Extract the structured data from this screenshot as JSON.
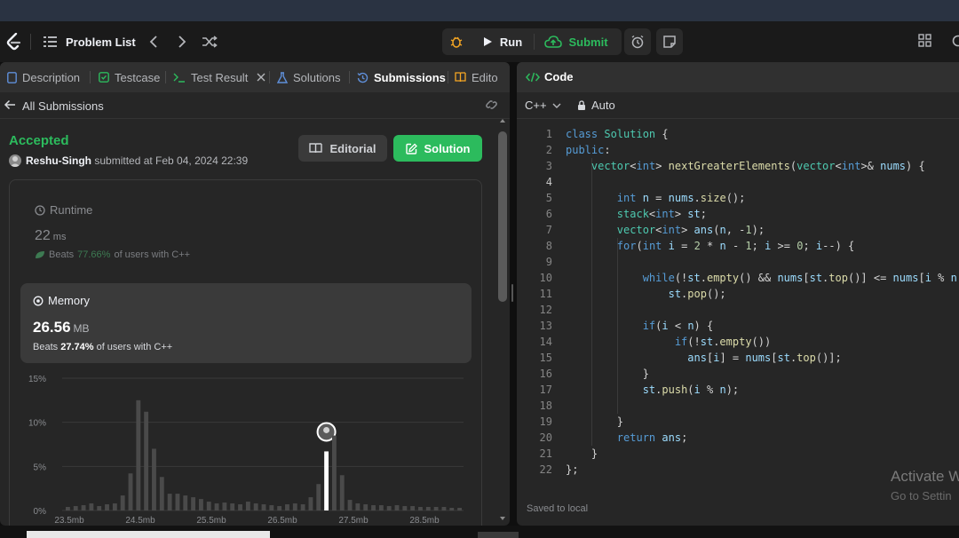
{
  "navbar": {
    "problem_list": "Problem List",
    "run": "Run",
    "submit": "Submit"
  },
  "left_tabs": [
    {
      "label": "Description"
    },
    {
      "label": "Testcase"
    },
    {
      "label": "Test Result"
    },
    {
      "label": "Solutions"
    },
    {
      "label": "Submissions"
    },
    {
      "label": "Edito"
    }
  ],
  "submission": {
    "back_label": "All Submissions",
    "status": "Accepted",
    "user": "Reshu-Singh",
    "submitted_text": "submitted at Feb 04, 2024 22:39",
    "editorial_btn": "Editorial",
    "solution_btn": "Solution",
    "runtime": {
      "title": "Runtime",
      "value": "22",
      "unit": "ms",
      "beats_label": "Beats",
      "beats_pct": "77.66%",
      "beats_suffix": "of users with C++"
    },
    "memory": {
      "title": "Memory",
      "value": "26.56",
      "unit": "MB",
      "beats_label": "Beats",
      "beats_pct": "27.74%",
      "beats_suffix": "of users with C++"
    }
  },
  "chart_data": {
    "type": "bar",
    "y_ticks": [
      "15%",
      "10%",
      "5%",
      "0%"
    ],
    "x_ticks": [
      "23.5mb",
      "24.5mb",
      "25.5mb",
      "26.5mb",
      "27.5mb",
      "28.5mb"
    ],
    "ylim": [
      0,
      15
    ],
    "values": [
      0.4,
      0.5,
      0.6,
      0.8,
      0.5,
      0.7,
      0.8,
      1.7,
      4.2,
      12.5,
      11.2,
      7.0,
      3.8,
      1.9,
      1.9,
      1.7,
      1.5,
      1.3,
      1.0,
      0.8,
      0.9,
      0.8,
      0.7,
      1.0,
      0.8,
      0.7,
      0.6,
      0.5,
      0.7,
      0.8,
      0.7,
      1.5,
      3.0,
      6.7,
      8.5,
      4.0,
      1.2,
      0.8,
      0.7,
      0.6,
      0.6,
      0.5,
      0.6,
      0.5,
      0.5,
      0.4,
      0.4,
      0.4,
      0.4,
      0.3,
      0.3
    ],
    "highlight_index": 33,
    "colors": {
      "bar": "#4a4a4a",
      "highlight": "#ffffff"
    }
  },
  "code_panel": {
    "tab_label": "Code",
    "language": "C++",
    "mode": "Auto",
    "saved": "Saved to local",
    "lines": [
      "class Solution {",
      "public:",
      "    vector<int> nextGreaterElements(vector<int>& nums) {",
      "",
      "        int n = nums.size();",
      "        stack<int> st;",
      "        vector<int> ans(n, -1);",
      "        for(int i = 2 * n - 1; i >= 0; i--) {",
      "",
      "            while(!st.empty() && nums[st.top()] <= nums[i % n",
      "                st.pop();",
      "",
      "            if(i < n) {",
      "                 if(!st.empty())",
      "                   ans[i] = nums[st.top()];",
      "            }",
      "            st.push(i % n);",
      "",
      "        }",
      "        return ans;",
      "    }",
      "};"
    ]
  },
  "watermark": {
    "line1": "Activate W",
    "line2": "Go to Settin"
  },
  "colors": {
    "accent_green": "#2cbb5d",
    "panel_bg": "#262626",
    "page_bg": "#0f0f0f"
  }
}
